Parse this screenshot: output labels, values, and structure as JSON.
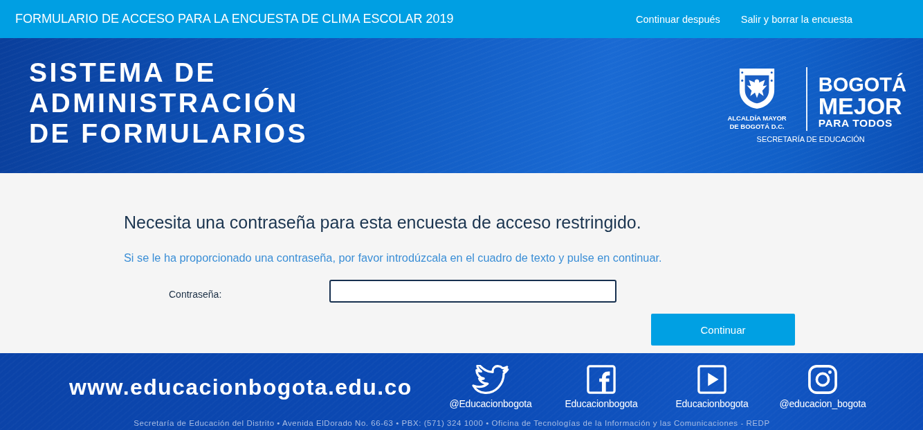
{
  "top_bar": {
    "title": "FORMULARIO DE ACCESO PARA LA ENCUESTA DE CLIMA ESCOLAR 2019",
    "links": [
      {
        "label": "Continuar después"
      },
      {
        "label": "Salir y borrar la encuesta"
      }
    ]
  },
  "banner": {
    "title_lines": [
      "SISTEMA DE",
      "ADMINISTRACIÓN",
      "DE FORMULARIOS"
    ],
    "logo": {
      "caption_lines": [
        "ALCALDÍA MAYOR",
        "DE BOGOTÁ D.C."
      ],
      "slogan_lines": [
        "BOGOTÁ",
        "MEJOR",
        "PARA TODOS"
      ],
      "department": "SECRETARÍA DE EDUCACIÓN"
    }
  },
  "login": {
    "heading": "Necesita una contraseña para esta encuesta de acceso restringido.",
    "instructions": "Si se le ha proporcionado una contraseña, por favor introdúzcala en el cuadro de texto y pulse en continuar.",
    "password_field": {
      "label": "Contraseña:"
    },
    "button": "Continuar"
  },
  "footer": {
    "website": "www.educacionbogota.edu.co",
    "social": [
      {
        "kind": "twitter",
        "handle": "@Educacionbogota"
      },
      {
        "kind": "facebook",
        "handle": "Educacionbogota"
      },
      {
        "kind": "youtube",
        "handle": "Educacionbogota"
      },
      {
        "kind": "instagram",
        "handle": "@educacion_bogota"
      }
    ],
    "address": "Secretaría de Educación del Distrito • Avenida ElDorado No. 66-63 • PBX: (571) 324 1000 • Oficina de Tecnologías de la Información y las Comunicaciones - REDP"
  }
}
